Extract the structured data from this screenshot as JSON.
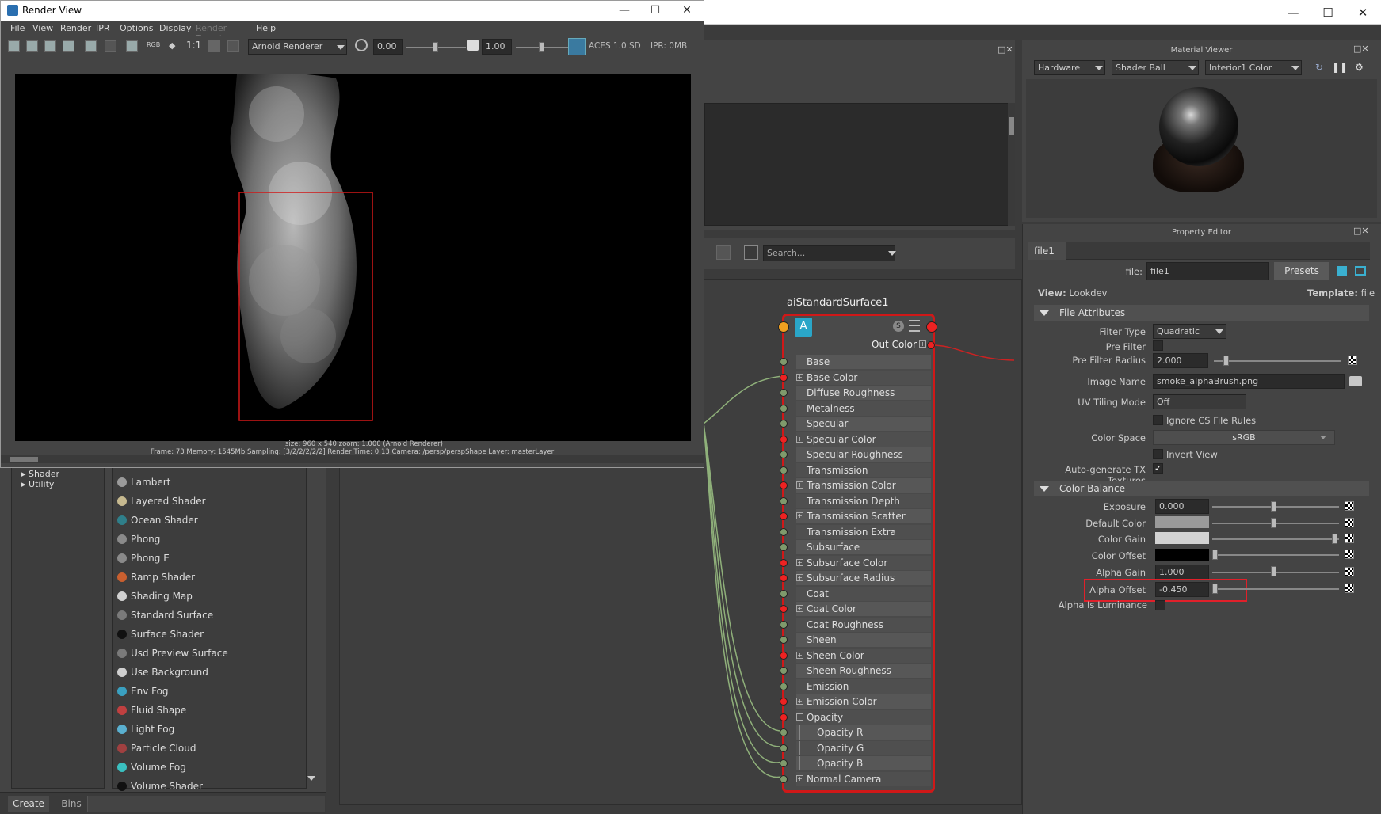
{
  "render_view": {
    "title": "Render View",
    "menus": [
      "File",
      "View",
      "Render",
      "IPR",
      "Options",
      "Display",
      "Render Target",
      "Help"
    ],
    "renderer": "Arnold Renderer",
    "exposure": "0.00",
    "gamma": "1.00",
    "color_space": "ACES 1.0 SD",
    "ipr": "IPR: 0MB",
    "ratio": "1:1",
    "rgb": "RGB",
    "status_size": "size: 960 x 540  zoom: 1.000     (Arnold Renderer)",
    "status_info": "Frame: 73     Memory: 1545Mb     Sampling: [3/2/2/2/2/2]     Render Time: 0:13     Camera: /persp/perspShape     Layer: masterLayer"
  },
  "hypershade": {
    "search_placeholder": "Search...",
    "tree_items": [
      "Shader",
      "Utility"
    ],
    "shader_list": [
      {
        "name": "Lambert",
        "color": "#9a9a9a"
      },
      {
        "name": "Layered Shader",
        "color": "#c6b98f"
      },
      {
        "name": "Ocean Shader",
        "color": "#2f7f8a"
      },
      {
        "name": "Phong",
        "color": "#8a8a8a"
      },
      {
        "name": "Phong E",
        "color": "#8a8a8a"
      },
      {
        "name": "Ramp Shader",
        "color": "#c95f2f"
      },
      {
        "name": "Shading Map",
        "color": "#d0d0d0"
      },
      {
        "name": "Standard Surface",
        "color": "#7a7a7a"
      },
      {
        "name": "Surface Shader",
        "color": "#111111"
      },
      {
        "name": "Usd Preview Surface",
        "color": "#7a7a7a"
      },
      {
        "name": "Use Background",
        "color": "#cfcfcf"
      },
      {
        "name": "Env Fog",
        "color": "#3aa0c0"
      },
      {
        "name": "Fluid Shape",
        "color": "#c04040"
      },
      {
        "name": "Light Fog",
        "color": "#5ab0d0"
      },
      {
        "name": "Particle Cloud",
        "color": "#a04040"
      },
      {
        "name": "Volume Fog",
        "color": "#3ac0c0"
      },
      {
        "name": "Volume Shader",
        "color": "#111111"
      }
    ],
    "bottom_tabs": [
      "Create",
      "Bins"
    ]
  },
  "node": {
    "title": "aiStandardSurface1",
    "badge_label": "A",
    "out_label": "Out Color",
    "attributes": [
      {
        "name": "Base",
        "port": "g",
        "indent": 0,
        "expand": false
      },
      {
        "name": "Base Color",
        "port": "r",
        "indent": 0,
        "expand": true
      },
      {
        "name": "Diffuse Roughness",
        "port": "g",
        "indent": 0,
        "expand": false
      },
      {
        "name": "Metalness",
        "port": "g",
        "indent": 0,
        "expand": false
      },
      {
        "name": "Specular",
        "port": "g",
        "indent": 0,
        "expand": false
      },
      {
        "name": "Specular Color",
        "port": "r",
        "indent": 0,
        "expand": true
      },
      {
        "name": "Specular Roughness",
        "port": "g",
        "indent": 0,
        "expand": false
      },
      {
        "name": "Transmission",
        "port": "g",
        "indent": 0,
        "expand": false
      },
      {
        "name": "Transmission Color",
        "port": "r",
        "indent": 0,
        "expand": true
      },
      {
        "name": "Transmission Depth",
        "port": "g",
        "indent": 0,
        "expand": false
      },
      {
        "name": "Transmission Scatter",
        "port": "r",
        "indent": 0,
        "expand": true
      },
      {
        "name": "Transmission Extra Roughness",
        "port": "g",
        "indent": 0,
        "expand": false
      },
      {
        "name": "Subsurface",
        "port": "g",
        "indent": 0,
        "expand": false
      },
      {
        "name": "Subsurface Color",
        "port": "r",
        "indent": 0,
        "expand": true
      },
      {
        "name": "Subsurface Radius",
        "port": "r",
        "indent": 0,
        "expand": true
      },
      {
        "name": "Coat",
        "port": "g",
        "indent": 0,
        "expand": false
      },
      {
        "name": "Coat Color",
        "port": "r",
        "indent": 0,
        "expand": true
      },
      {
        "name": "Coat Roughness",
        "port": "g",
        "indent": 0,
        "expand": false
      },
      {
        "name": "Sheen",
        "port": "g",
        "indent": 0,
        "expand": false
      },
      {
        "name": "Sheen Color",
        "port": "r",
        "indent": 0,
        "expand": true
      },
      {
        "name": "Sheen Roughness",
        "port": "g",
        "indent": 0,
        "expand": false
      },
      {
        "name": "Emission",
        "port": "g",
        "indent": 0,
        "expand": false
      },
      {
        "name": "Emission Color",
        "port": "r",
        "indent": 0,
        "expand": true
      },
      {
        "name": "Opacity",
        "port": "r",
        "indent": 0,
        "expand": true
      },
      {
        "name": "Opacity R",
        "port": "g",
        "indent": 1,
        "expand": false
      },
      {
        "name": "Opacity G",
        "port": "g",
        "indent": 1,
        "expand": false
      },
      {
        "name": "Opacity B",
        "port": "g",
        "indent": 1,
        "expand": false
      },
      {
        "name": "Normal Camera",
        "port": "g",
        "indent": 0,
        "expand": true
      }
    ]
  },
  "material_viewer": {
    "title": "Material Viewer",
    "mode": "Hardware",
    "geometry": "Shader Ball",
    "environment": "Interior1 Color"
  },
  "property_editor": {
    "title": "Property Editor",
    "tab": "file1",
    "file_label": "file:",
    "file_value": "file1",
    "presets": "Presets",
    "view_label": "View:",
    "view_value": "Lookdev",
    "template_label": "Template:",
    "template_value": "file",
    "file_attributes": {
      "header": "File Attributes",
      "filter_type_label": "Filter Type",
      "filter_type": "Quadratic",
      "pre_filter_label": "Pre Filter",
      "pre_filter_radius_label": "Pre Filter Radius",
      "pre_filter_radius": "2.000",
      "image_name_label": "Image Name",
      "image_name": "smoke_alphaBrush.png",
      "uv_tiling_label": "UV Tiling Mode",
      "uv_tiling": "Off",
      "ignore_cs_label": "Ignore CS File Rules",
      "color_space_label": "Color Space",
      "color_space": "sRGB",
      "invert_view_label": "Invert View",
      "auto_tx_label": "Auto-generate TX Textures",
      "auto_tx_checked": "✓"
    },
    "color_balance": {
      "header": "Color Balance",
      "exposure_label": "Exposure",
      "exposure": "0.000",
      "default_color_label": "Default Color",
      "color_gain_label": "Color Gain",
      "color_offset_label": "Color Offset",
      "alpha_gain_label": "Alpha Gain",
      "alpha_gain": "1.000",
      "alpha_offset_label": "Alpha Offset",
      "alpha_offset": "-0.450",
      "alpha_is_luminance_label": "Alpha Is Luminance"
    }
  }
}
